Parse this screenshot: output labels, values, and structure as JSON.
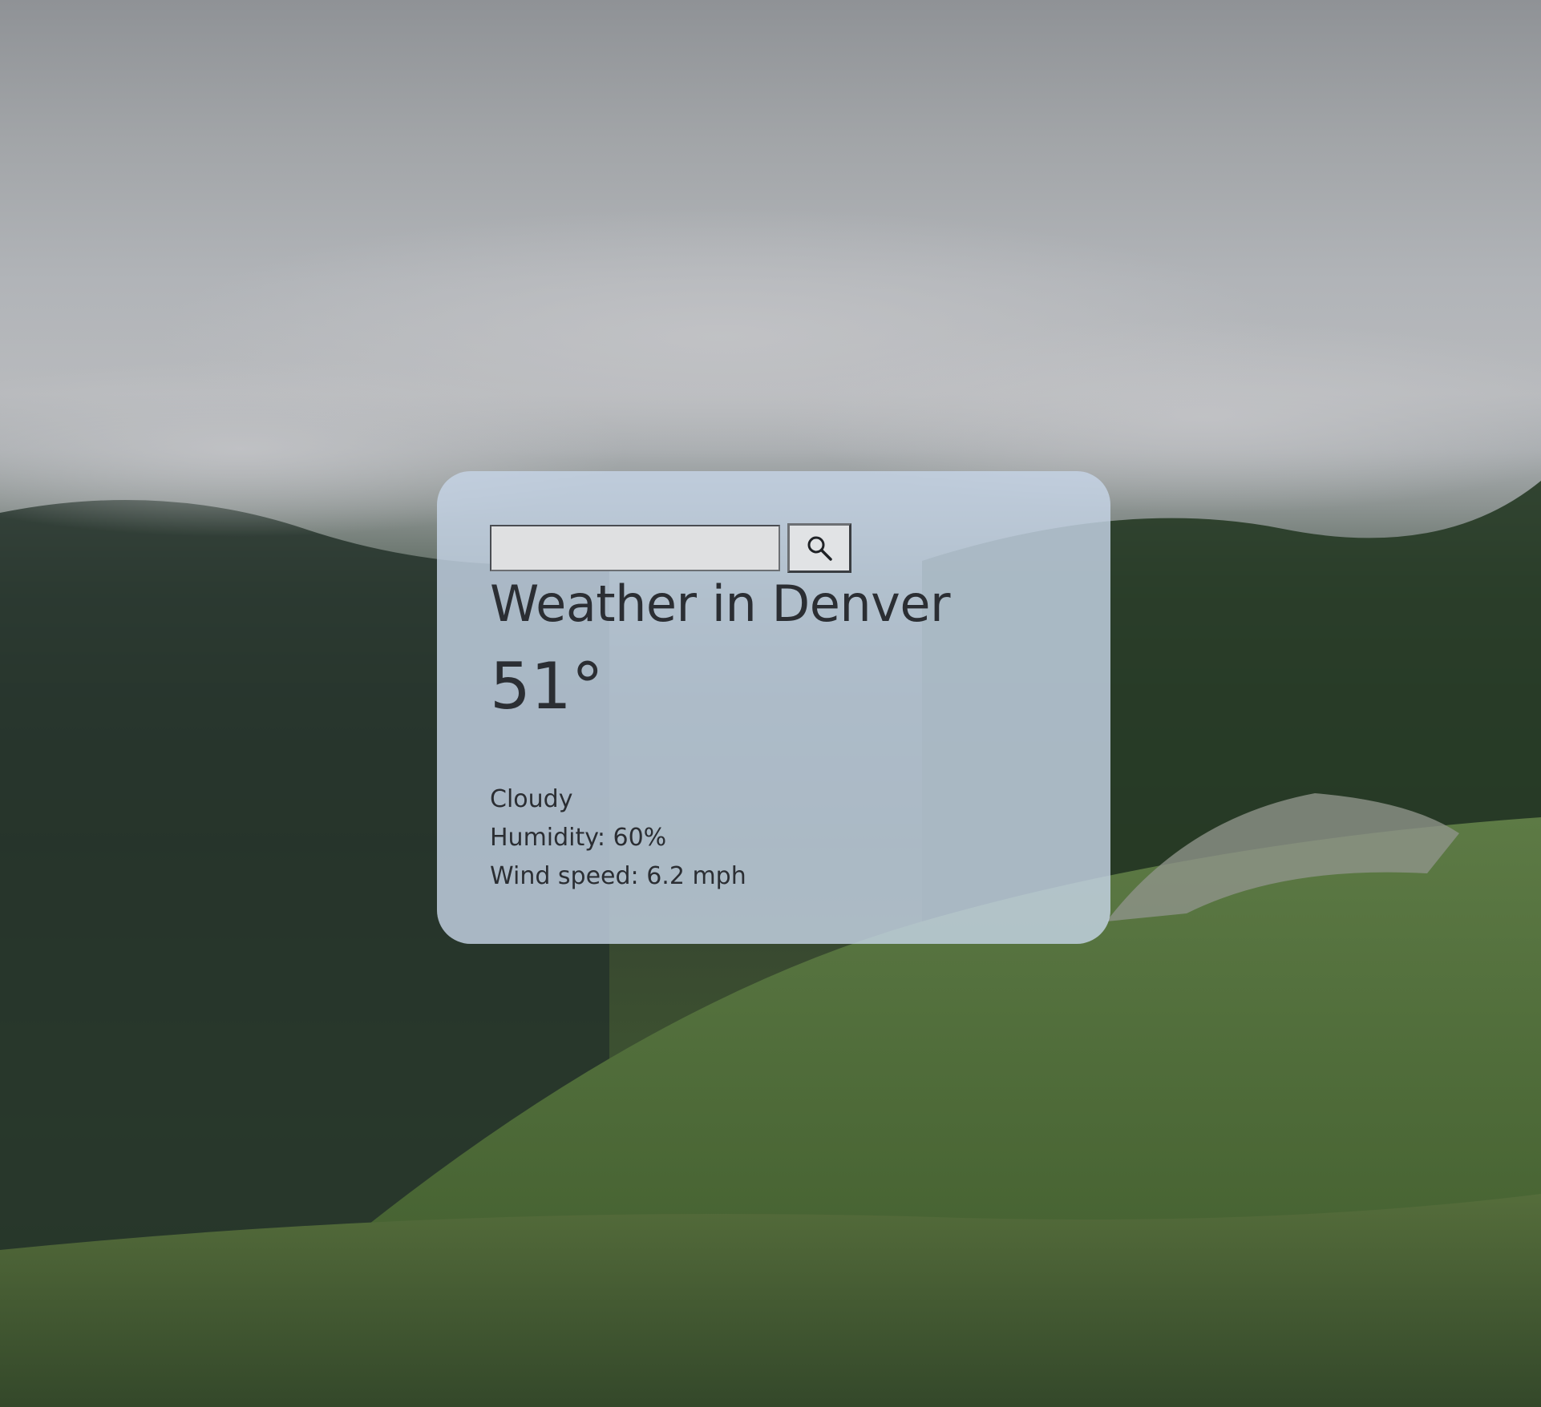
{
  "search": {
    "value": "",
    "placeholder": ""
  },
  "weather": {
    "title": "Weather in Denver",
    "temperature": "51°",
    "description": "Cloudy",
    "humidity": "Humidity: 60%",
    "wind": "Wind speed: 6.2 mph"
  },
  "icons": {
    "search_button": "search-icon"
  },
  "colors": {
    "card_background": "#c6d4e6",
    "text": "#2b2e33",
    "input_background": "#dfe0e1"
  }
}
